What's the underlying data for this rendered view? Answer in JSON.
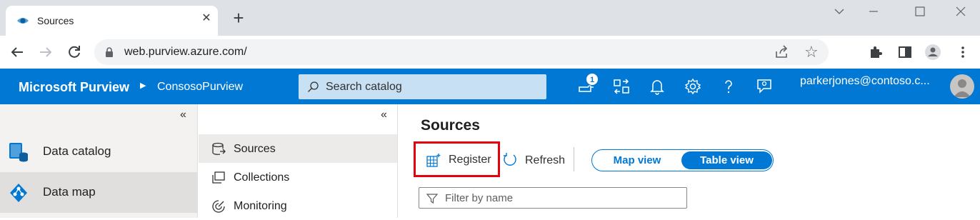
{
  "browser": {
    "tab_title": "Sources",
    "url": "web.purview.azure.com/",
    "new_tab_symbol": "+",
    "close_symbol": "✕"
  },
  "app": {
    "brand": "Microsoft Purview",
    "breadcrumb": "ConsosoPurview",
    "search_placeholder": "Search catalog",
    "notification_count": "1",
    "user": "parkerjones@contoso.c...",
    "accent_color": "#0078d4"
  },
  "left_nav": {
    "collapse_symbol": "«",
    "items": [
      {
        "label": "Data catalog",
        "icon": "data-catalog-icon"
      },
      {
        "label": "Data map",
        "icon": "data-map-icon",
        "active": true
      }
    ]
  },
  "sub_nav": {
    "collapse_symbol": "«",
    "items": [
      {
        "label": "Sources",
        "icon": "sources-icon",
        "active": true
      },
      {
        "label": "Collections",
        "icon": "collections-icon"
      },
      {
        "label": "Monitoring",
        "icon": "monitoring-icon"
      }
    ]
  },
  "main": {
    "title": "Sources",
    "register_label": "Register",
    "refresh_label": "Refresh",
    "view_toggle": {
      "map": "Map view",
      "table": "Table view",
      "selected": "Table view"
    },
    "filter_placeholder": "Filter by name",
    "highlight_color": "#e3000f"
  }
}
